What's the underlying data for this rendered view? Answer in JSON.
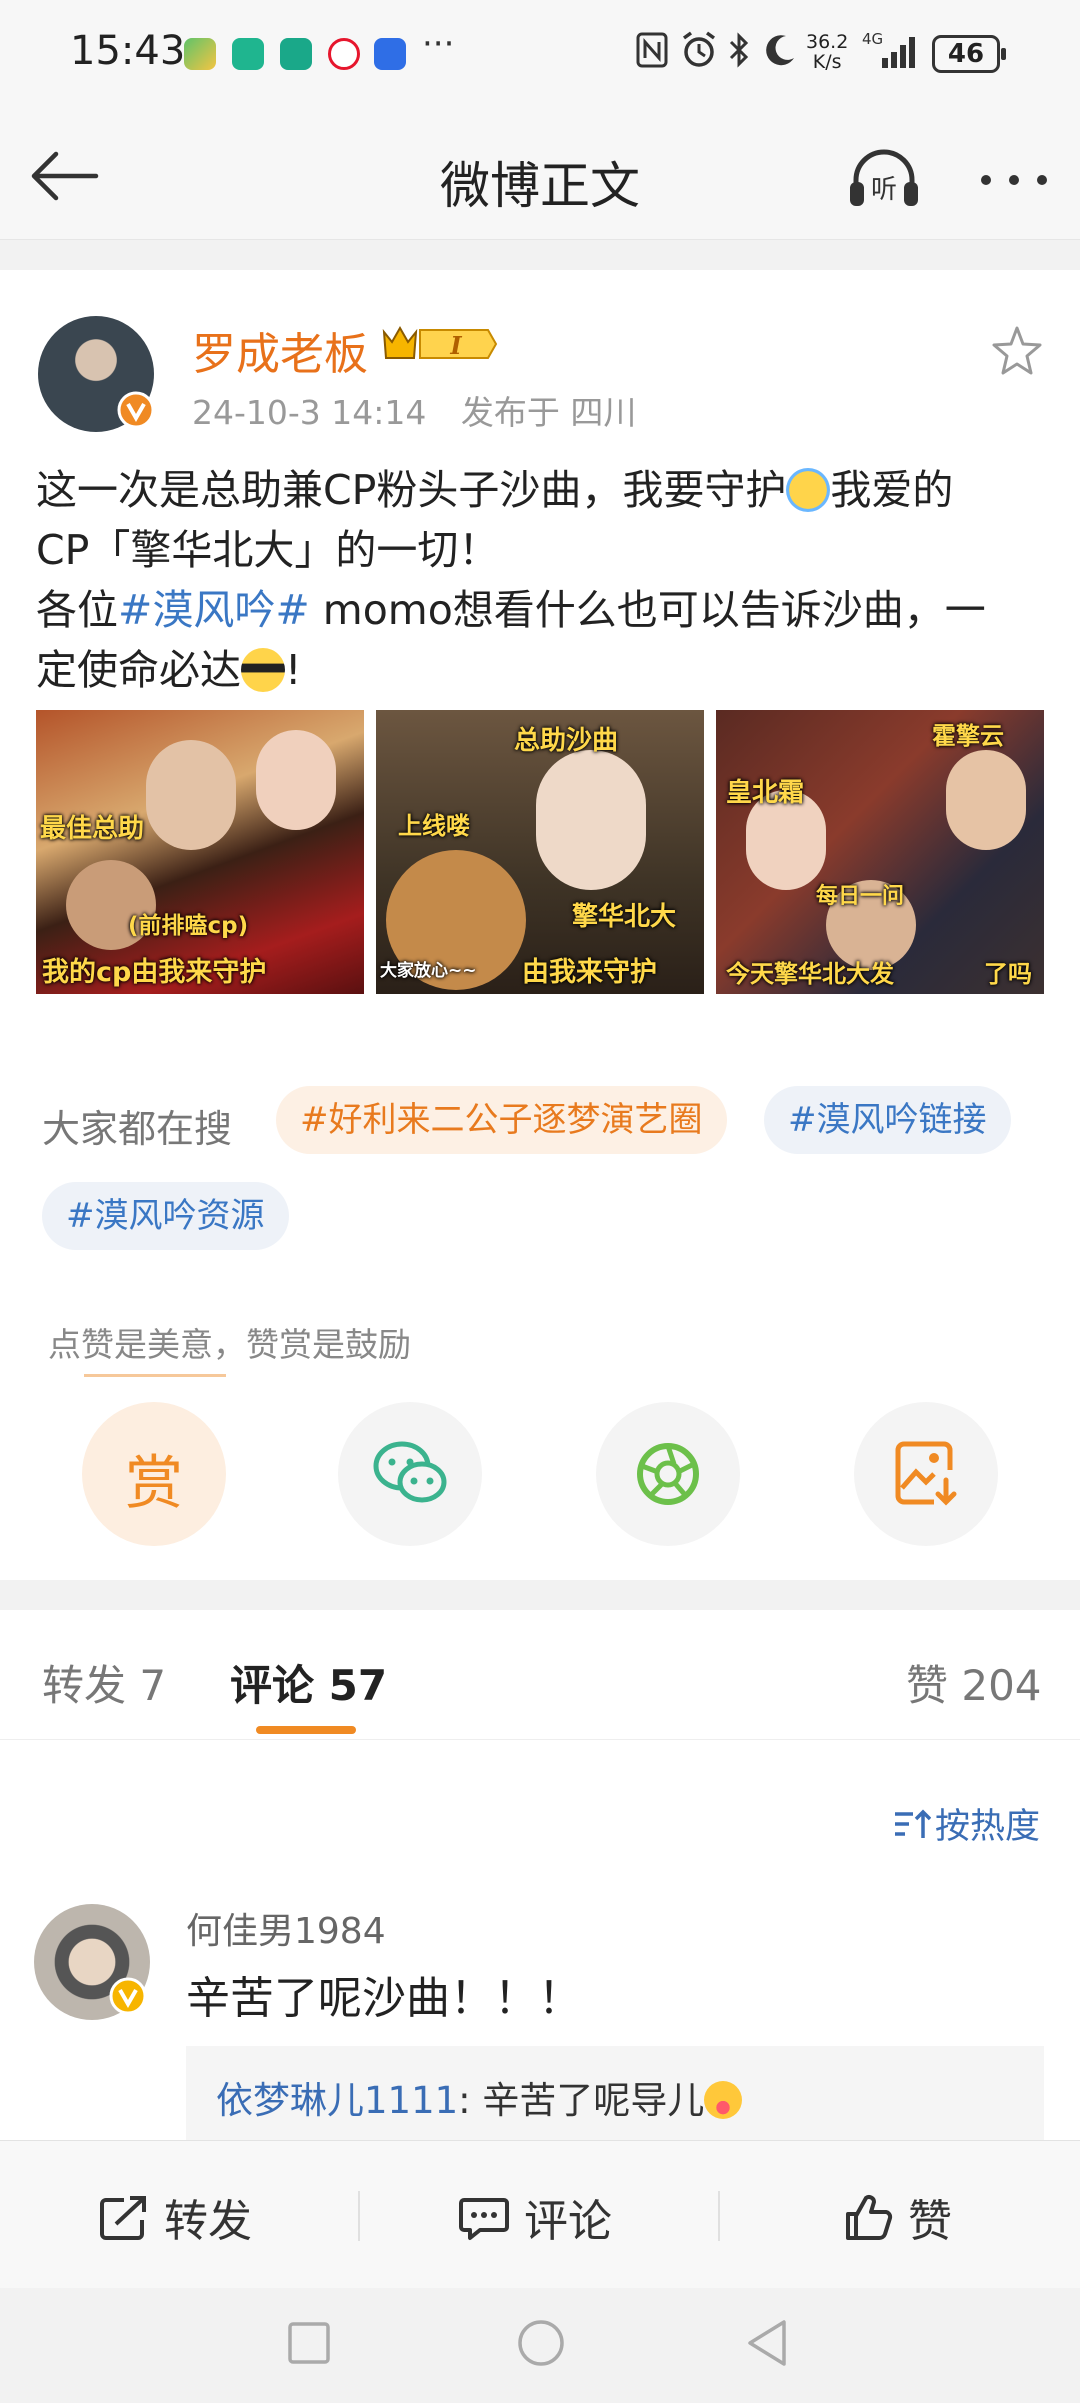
{
  "status_bar": {
    "time": "15:43",
    "network_speed": "36.2",
    "network_unit": "K/s",
    "network_type": "4G",
    "battery": "46"
  },
  "nav": {
    "title": "微博正文",
    "listen_label": "听"
  },
  "post": {
    "author": "罗成老板",
    "vip_badge": "I",
    "time": "24-10-3 14:14",
    "location": "发布于 四川",
    "text_line1_a": "这一次是总助兼CP粉头子沙曲，我要守护",
    "text_line1_b": "我爱的",
    "text_line2": "CP「擎华北大」的一切！",
    "text_line3_a": "各位",
    "topic": "#漠风吟#",
    "text_line3_b": " momo想看什么也可以告诉沙曲，一",
    "text_line4": "定使命必达",
    "text_line4_end": "!",
    "images": [
      {
        "captions": [
          "最佳总助",
          "(前排嗑cp)",
          "我的cp由我来守护"
        ]
      },
      {
        "captions": [
          "总助沙曲",
          "上线喽",
          "擎华北大",
          "由我来守护",
          "大家放心~~"
        ]
      },
      {
        "captions": [
          "霍擎云",
          "皇北霜",
          "每日一问",
          "今天擎华北大发",
          "了吗"
        ]
      }
    ]
  },
  "hot_search": {
    "label": "大家都在搜",
    "chips": [
      "#好利来二公子逐梦演艺圈",
      "#漠风吟链接",
      "#漠风吟资源"
    ]
  },
  "reward": {
    "hint": "点赞是美意，赞赏是鼓励",
    "reward_label": "赏"
  },
  "tabs": {
    "repost": "转发 7",
    "comments": "评论 57",
    "likes": "赞 204"
  },
  "comments": {
    "sort_label": "按热度",
    "items": [
      {
        "user": "何佳男1984",
        "text": "辛苦了呢沙曲！！！",
        "reply_user": "依梦琳儿1111",
        "reply_text": ": 辛苦了呢导儿"
      }
    ]
  },
  "actions": {
    "repost": "转发",
    "comment": "评论",
    "like": "赞"
  },
  "colors": {
    "accent": "#f08a23",
    "link": "#3a77c4",
    "author": "#e8711a"
  }
}
